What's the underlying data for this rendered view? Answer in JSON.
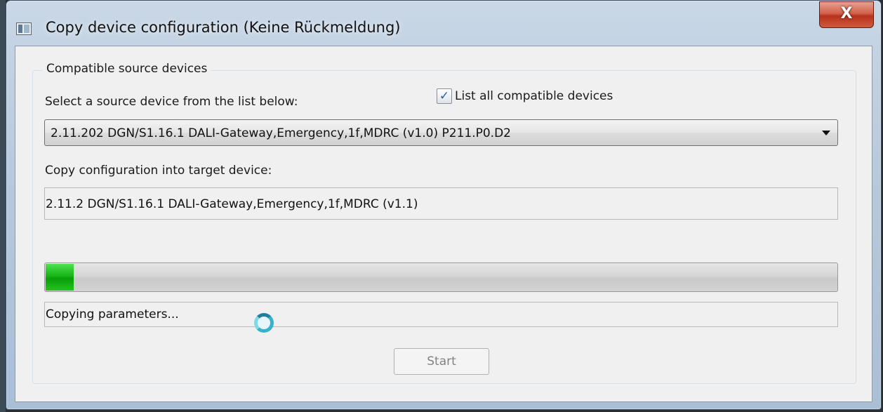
{
  "window": {
    "title": "Copy device configuration (Keine Rückmeldung)",
    "close_label": "X"
  },
  "group": {
    "legend": "Compatible source devices"
  },
  "source": {
    "label": "Select a source device from the list below:",
    "selected": "2.11.202 DGN/S1.16.1 DALI-Gateway,Emergency,1f,MDRC (v1.0) P211.P0.D2"
  },
  "list_all": {
    "label": "List all compatible devices",
    "checked": true,
    "check_glyph": "✓"
  },
  "target": {
    "label": "Copy configuration into target device:",
    "value": "2.11.2 DGN/S1.16.1 DALI-Gateway,Emergency,1f,MDRC (v1.1)"
  },
  "progress": {
    "fraction": 0.035,
    "status": "Copying parameters..."
  },
  "buttons": {
    "start_label": "Start"
  },
  "icons": {
    "window": "app-window-icon",
    "busy": "busy-spinner-icon"
  },
  "colors": {
    "progress_fill": "#17b517",
    "close_button": "#c8452d"
  }
}
